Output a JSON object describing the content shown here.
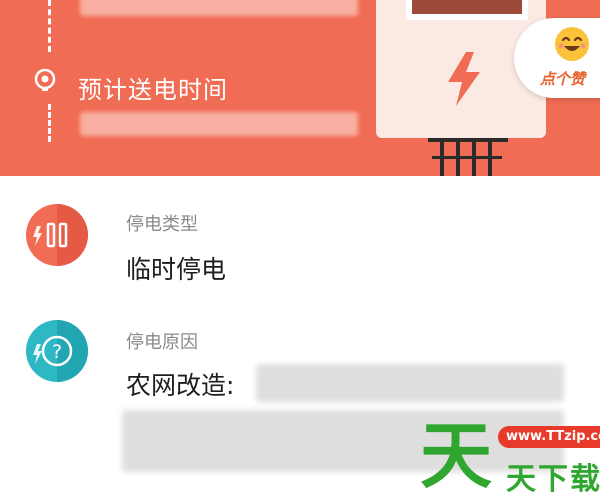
{
  "banner": {
    "background_color": "#f06c54",
    "time_label": "预计送电时间",
    "like_badge": {
      "label": "点个赞",
      "icon": "smiley-icon"
    },
    "bulb_icon": "lightbulb-icon",
    "bolt_icon": "lightning-bolt-icon"
  },
  "outage_type": {
    "label": "停电类型",
    "value": "临时停电",
    "icon": "pause-bolt-icon",
    "icon_color": "#f06c54"
  },
  "outage_reason": {
    "label": "停电原因",
    "value": "农网改造:",
    "icon": "question-icon",
    "icon_color": "#2eb8c4"
  },
  "watermark": {
    "url": "www.TTzip.com",
    "glyph": "天",
    "text": "天下载"
  }
}
